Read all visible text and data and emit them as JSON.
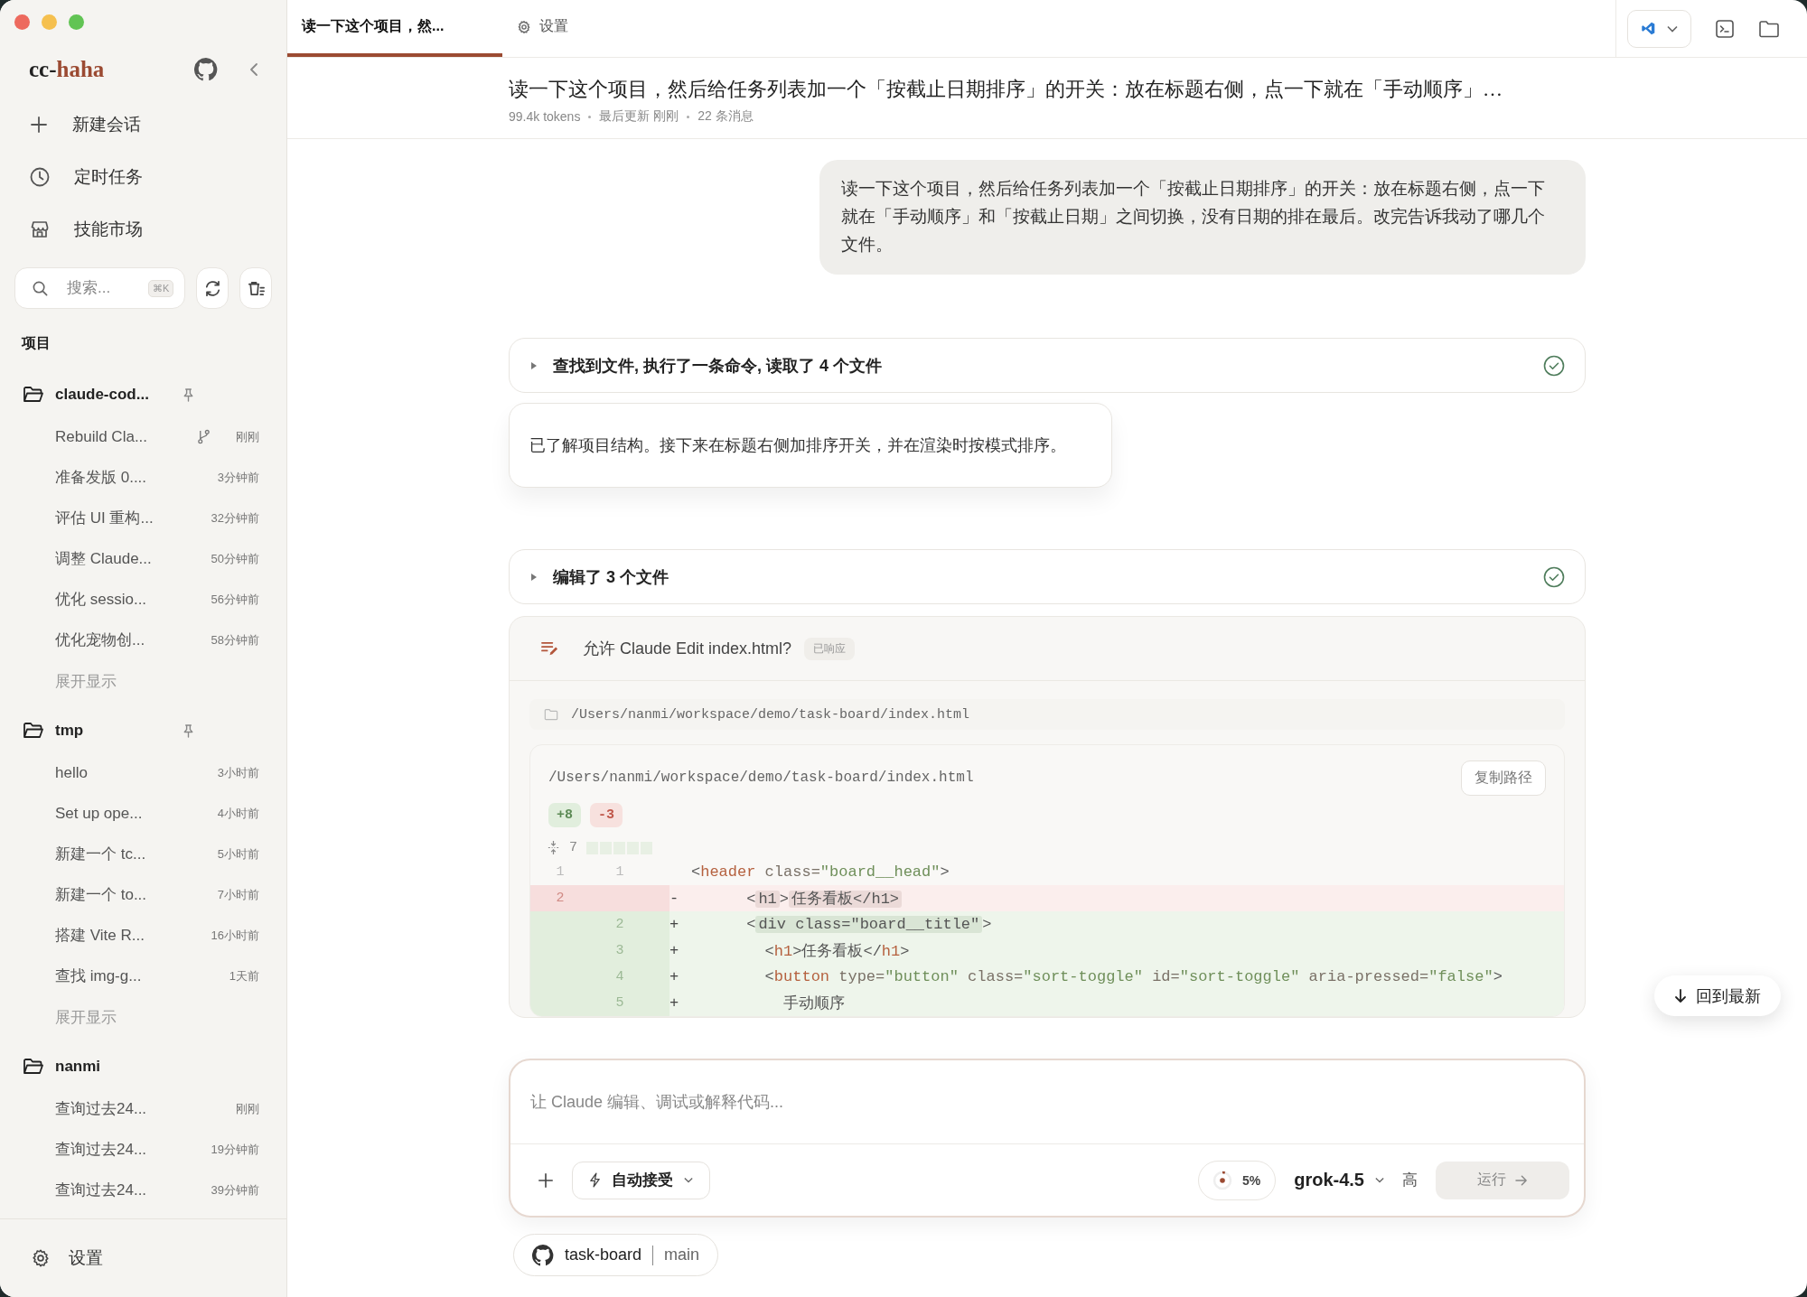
{
  "sidebar": {
    "brand": {
      "prefix": "cc-",
      "accent": "haha"
    },
    "nav": [
      {
        "kind": "new",
        "label": "新建会话"
      },
      {
        "kind": "schedule",
        "label": "定时任务"
      },
      {
        "kind": "market",
        "label": "技能市场"
      }
    ],
    "search": {
      "placeholder": "搜索...",
      "shortcut": "⌘K"
    },
    "section_title": "项目",
    "projects": [
      {
        "name": "claude-cod...",
        "pinned": true,
        "more": "展开显示",
        "sessions": [
          {
            "title": "Rebuild Cla...",
            "branch": true,
            "time": "刚刚"
          },
          {
            "title": "准备发版 0....",
            "branch": false,
            "time": "3分钟前"
          },
          {
            "title": "评估 UI 重构...",
            "branch": false,
            "time": "32分钟前"
          },
          {
            "title": "调整 Claude...",
            "branch": false,
            "time": "50分钟前"
          },
          {
            "title": "优化 sessio...",
            "branch": false,
            "time": "56分钟前"
          },
          {
            "title": "优化宠物创...",
            "branch": false,
            "time": "58分钟前"
          }
        ]
      },
      {
        "name": "tmp",
        "pinned": true,
        "more": "展开显示",
        "sessions": [
          {
            "title": "hello",
            "branch": false,
            "time": "3小时前"
          },
          {
            "title": "Set up ope...",
            "branch": false,
            "time": "4小时前"
          },
          {
            "title": "新建一个 tc...",
            "branch": false,
            "time": "5小时前"
          },
          {
            "title": "新建一个 to...",
            "branch": false,
            "time": "7小时前"
          },
          {
            "title": "搭建 Vite R...",
            "branch": false,
            "time": "16小时前"
          },
          {
            "title": "查找 img-g...",
            "branch": false,
            "time": "1天前"
          }
        ]
      },
      {
        "name": "nanmi",
        "pinned": false,
        "sessions": [
          {
            "title": "查询过去24...",
            "branch": false,
            "time": "刚刚"
          },
          {
            "title": "查询过去24...",
            "branch": false,
            "time": "19分钟前"
          },
          {
            "title": "查询过去24...",
            "branch": false,
            "time": "39分钟前"
          }
        ]
      }
    ],
    "settings": "设置"
  },
  "tabs": [
    {
      "kind": "chat",
      "label": "读一下这个项目，然...",
      "selected": true
    },
    {
      "kind": "settings",
      "label": "设置",
      "selected": false
    }
  ],
  "header": {
    "title": "读一下这个项目，然后给任务列表加一个「按截止日期排序」的开关：放在标题右侧，点一下就在「手动顺序」…",
    "meta": [
      "99.4k tokens",
      "最后更新 刚刚",
      "22 条消息"
    ]
  },
  "messages": [
    {
      "kind": "user",
      "text": "读一下这个项目，然后给任务列表加一个「按截止日期排序」的开关：放在标题右侧，点一下就在「手动顺序」和「按截止日期」之间切换，没有日期的排在最后。改完告诉我动了哪几个文件。"
    },
    {
      "kind": "tools",
      "label": "查找到文件, 执行了一条命令, 读取了 4 个文件",
      "done": true
    },
    {
      "kind": "assistant",
      "text": "已了解项目结构。接下来在标题右侧加排序开关，并在渲染时按模式排序。"
    },
    {
      "kind": "tools",
      "label": "编辑了 3 个文件",
      "done": true
    },
    {
      "kind": "permission",
      "title": "允许 Claude Edit index.html?",
      "status": "已响应",
      "path": "/Users/nanmi/workspace/demo/task-board/index.html",
      "diff": {
        "path": "/Users/nanmi/workspace/demo/task-board/index.html",
        "copy_label": "复制路径",
        "added": "+8",
        "removed": "-3",
        "collapsed": "7",
        "lines": [
          {
            "kind": "context",
            "old": "1",
            "new": "1",
            "tokens": [
              {
                "kind": "plain",
                "text": "<"
              },
              {
                "kind": "tag",
                "text": "header"
              },
              {
                "kind": "attr",
                "text": " class="
              },
              {
                "kind": "str",
                "text": "\"board__head\""
              },
              {
                "kind": "plain",
                "text": ">"
              }
            ]
          },
          {
            "kind": "del",
            "old": "2",
            "sign": "-",
            "tokens": [
              {
                "kind": "plain",
                "text": "      <"
              },
              {
                "kind": "hl",
                "text": "h1"
              },
              {
                "kind": "plain",
                "text": ">"
              },
              {
                "kind": "hl",
                "text": "任务看板</h1>"
              }
            ]
          },
          {
            "kind": "add",
            "new": "2",
            "sign": "+",
            "tokens": [
              {
                "kind": "plain",
                "text": "      <"
              },
              {
                "kind": "hl",
                "text": "div class=\"board__title\""
              },
              {
                "kind": "plain",
                "text": ">"
              }
            ]
          },
          {
            "kind": "add",
            "new": "3",
            "sign": "+",
            "tokens": [
              {
                "kind": "plain",
                "text": "        <"
              },
              {
                "kind": "tag",
                "text": "h1"
              },
              {
                "kind": "plain",
                "text": ">任务看板</"
              },
              {
                "kind": "tag",
                "text": "h1"
              },
              {
                "kind": "plain",
                "text": ">"
              }
            ]
          },
          {
            "kind": "add",
            "new": "4",
            "sign": "+",
            "tokens": [
              {
                "kind": "plain",
                "text": "        <"
              },
              {
                "kind": "tag",
                "text": "button"
              },
              {
                "kind": "attr",
                "text": " type="
              },
              {
                "kind": "str",
                "text": "\"button\""
              },
              {
                "kind": "attr",
                "text": " class="
              },
              {
                "kind": "str",
                "text": "\"sort-toggle\""
              },
              {
                "kind": "attr",
                "text": " id="
              },
              {
                "kind": "str",
                "text": "\"sort-toggle\""
              },
              {
                "kind": "attr",
                "text": " aria-pressed="
              },
              {
                "kind": "str",
                "text": "\"false\""
              },
              {
                "kind": "plain",
                "text": ">"
              }
            ]
          },
          {
            "kind": "add",
            "new": "5",
            "sign": "+",
            "tokens": [
              {
                "kind": "plain",
                "text": "          手动顺序"
              }
            ]
          }
        ]
      }
    }
  ],
  "scroll_button": "回到最新",
  "composer": {
    "placeholder": "让 Claude 编辑、调试或解释代码...",
    "mode": "自动接受",
    "context": {
      "label": "5%",
      "level": 0.05
    },
    "model": "grok-4.5",
    "effort": "高",
    "send": {
      "label": "运行",
      "disabled": true
    }
  },
  "repo": {
    "name": "task-board",
    "branch": "main"
  }
}
